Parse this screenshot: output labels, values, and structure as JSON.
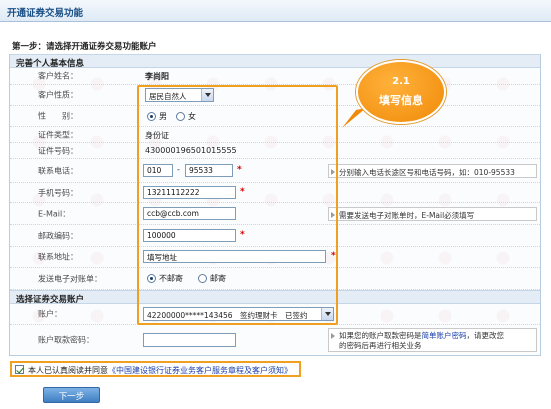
{
  "title": "开通证券交易功能",
  "step_title": "第一步：请选择开通证券交易功能账户",
  "section_basic": "完善个人基本信息",
  "section_account": "选择证券交易账户",
  "callout": {
    "num": "2.1",
    "text": "填写信息"
  },
  "fields": {
    "name": {
      "label": "客户姓名：",
      "value": "李尚阳"
    },
    "nature": {
      "label": "客户性质：",
      "value": "居民自然人"
    },
    "gender": {
      "label": "性　　别：",
      "options": [
        "男",
        "女"
      ],
      "selected": "男"
    },
    "id_type": {
      "label": "证件类型：",
      "value": "身份证"
    },
    "id_number": {
      "label": "证件号码：",
      "value": "430000196501015555"
    },
    "phone": {
      "label": "联系电话：",
      "area": "010",
      "dash": "-",
      "number": "95533",
      "hint": "分别输入电话长途区号和电话号码，如：010-95533"
    },
    "mobile": {
      "label": "手机号码：",
      "value": "13211112222"
    },
    "email": {
      "label": "E-Mail：",
      "value": "ccb@ccb.com",
      "hint": "需要发送电子对账单时，E-Mail必须填写"
    },
    "postcode": {
      "label": "邮政编码：",
      "value": "100000"
    },
    "address": {
      "label": "联系地址：",
      "value": "填写地址"
    },
    "statement": {
      "label": "发送电子对账单：",
      "options": [
        "不邮寄",
        "邮寄"
      ],
      "selected": "不邮寄"
    },
    "account": {
      "label": "账户：",
      "value": "42200000*****143456　签约理财卡　已签约"
    },
    "password": {
      "label": "账户取款密码：",
      "value": "",
      "hint_line1": "如果您的账户取款密码是简单账户密码，请更改您",
      "hint_line2": "的密码后再进行相关业务",
      "hint_link": "简单账户密码"
    }
  },
  "agree": {
    "text": "本人已认真阅读并同意",
    "link": "《中国建设银行证券业务客户服务章程及客户须知》",
    "checked": true
  },
  "next_button": "下一步",
  "colors": {
    "accent_orange": "#f0a020",
    "required_star": "#d40000",
    "title_blue": "#1a4f86"
  }
}
